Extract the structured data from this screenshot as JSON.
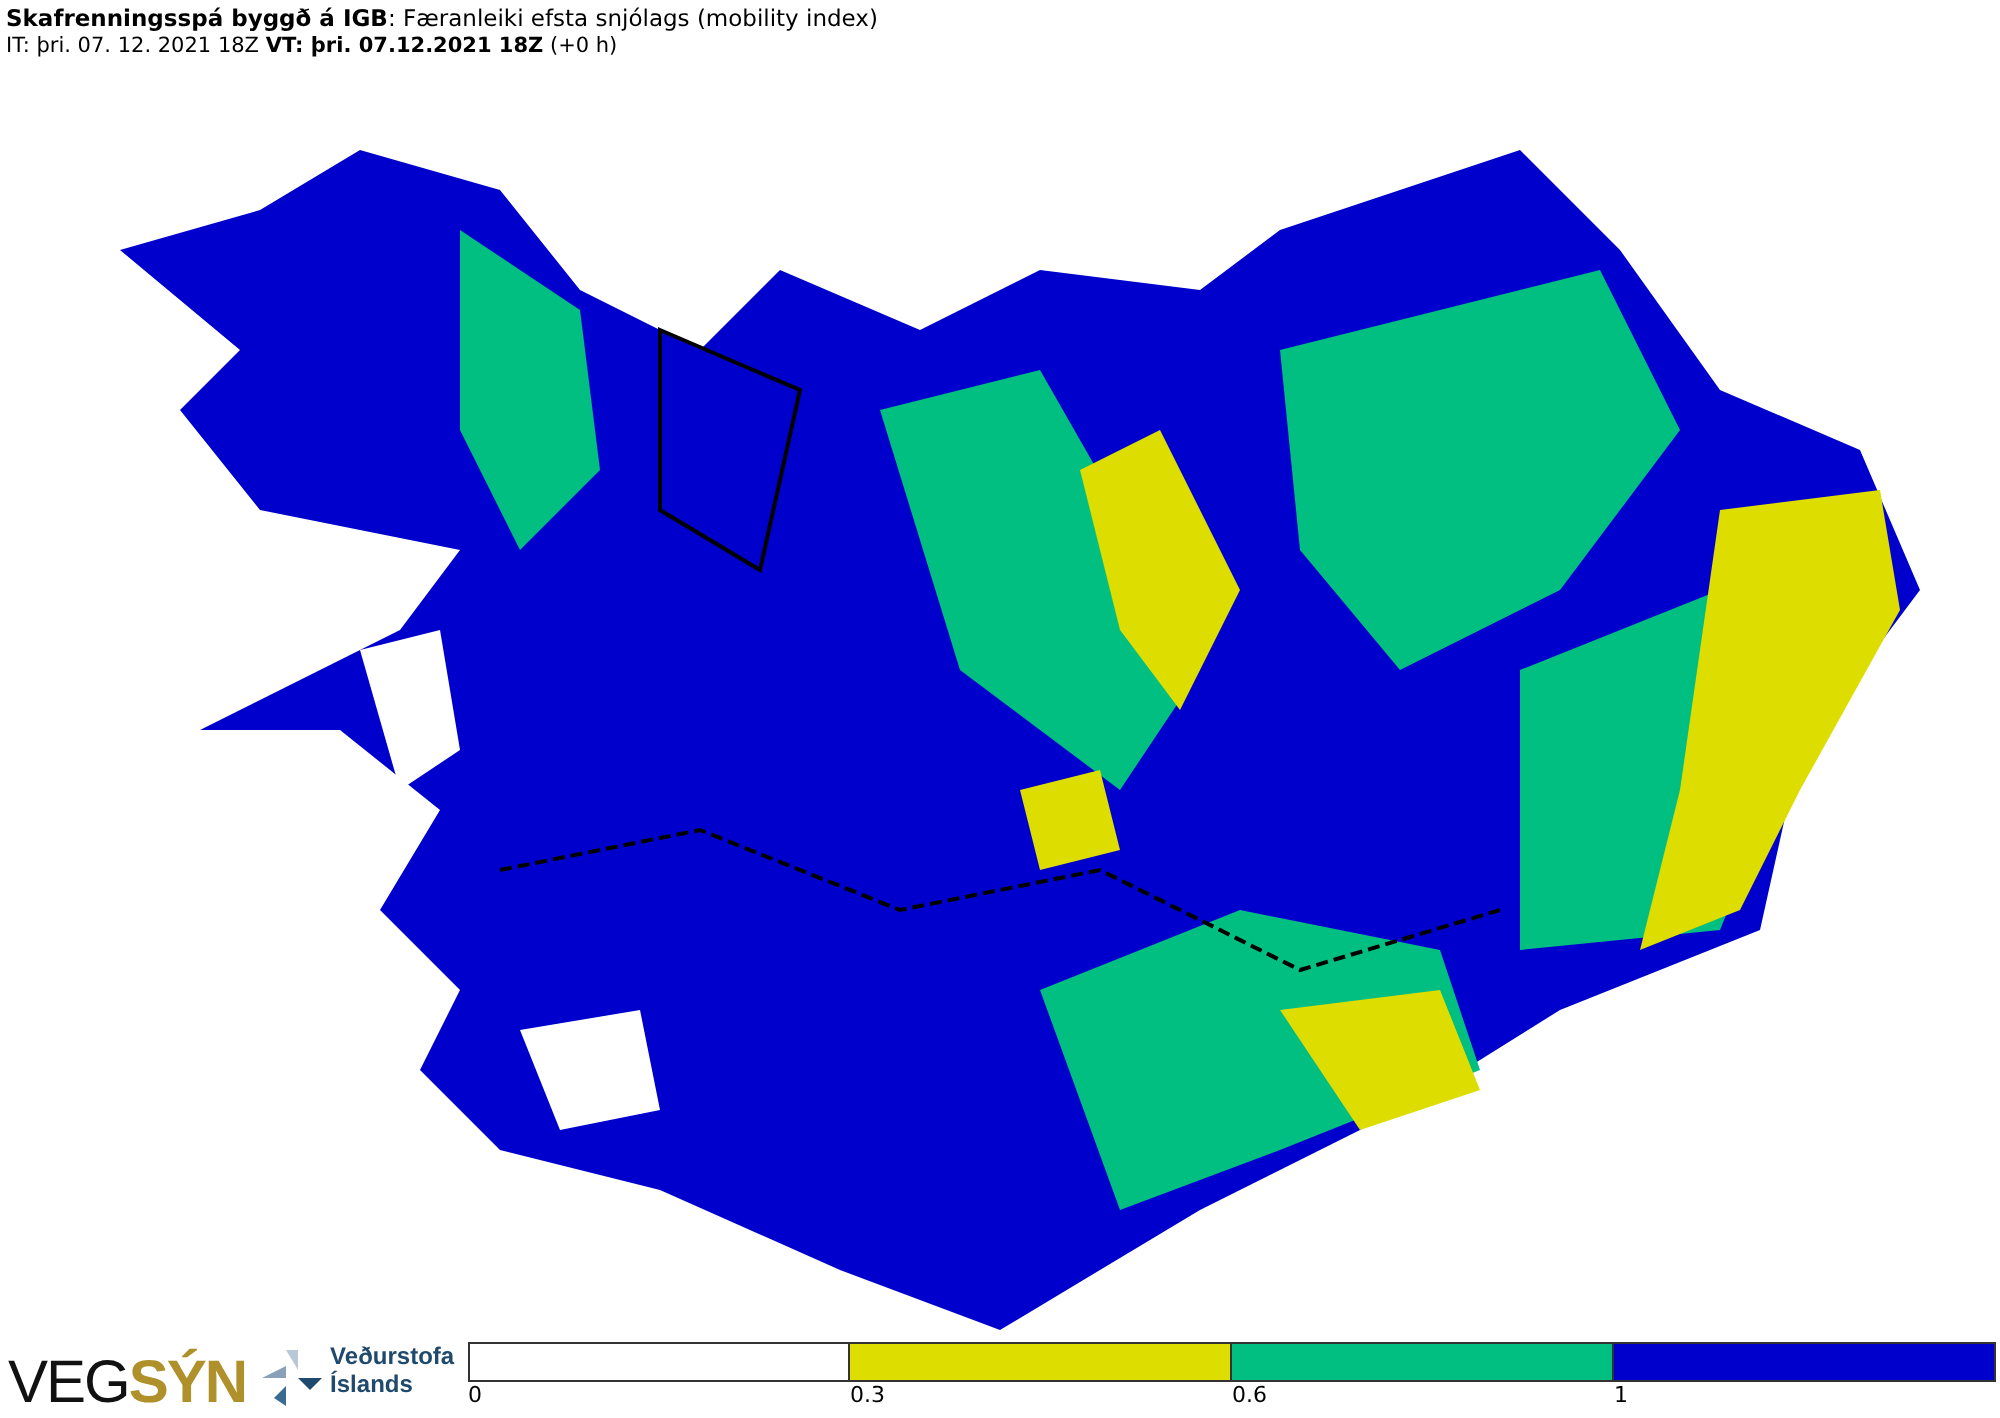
{
  "header": {
    "title": "**Skafrenningsspá byggð á IGB**: Færanleiki efsta snjólags (mobility index)",
    "times": "IT: þri. 07. 12. 2021 18Z **VT: þri. 07.12.2021 18Z** (+0 h)"
  },
  "logos": {
    "vegsyn": [
      "VEG",
      "SÝN"
    ],
    "vedurstofa": [
      "Veðurstofa",
      "Íslands"
    ]
  },
  "legend": [
    {
      "color": "#ffffff",
      "tick": "0"
    },
    {
      "color": "#dddd00",
      "tick": "0.3"
    },
    {
      "color": "#00bf80",
      "tick": "0.6"
    },
    {
      "color": "#0000cc",
      "tick": "1"
    }
  ]
}
